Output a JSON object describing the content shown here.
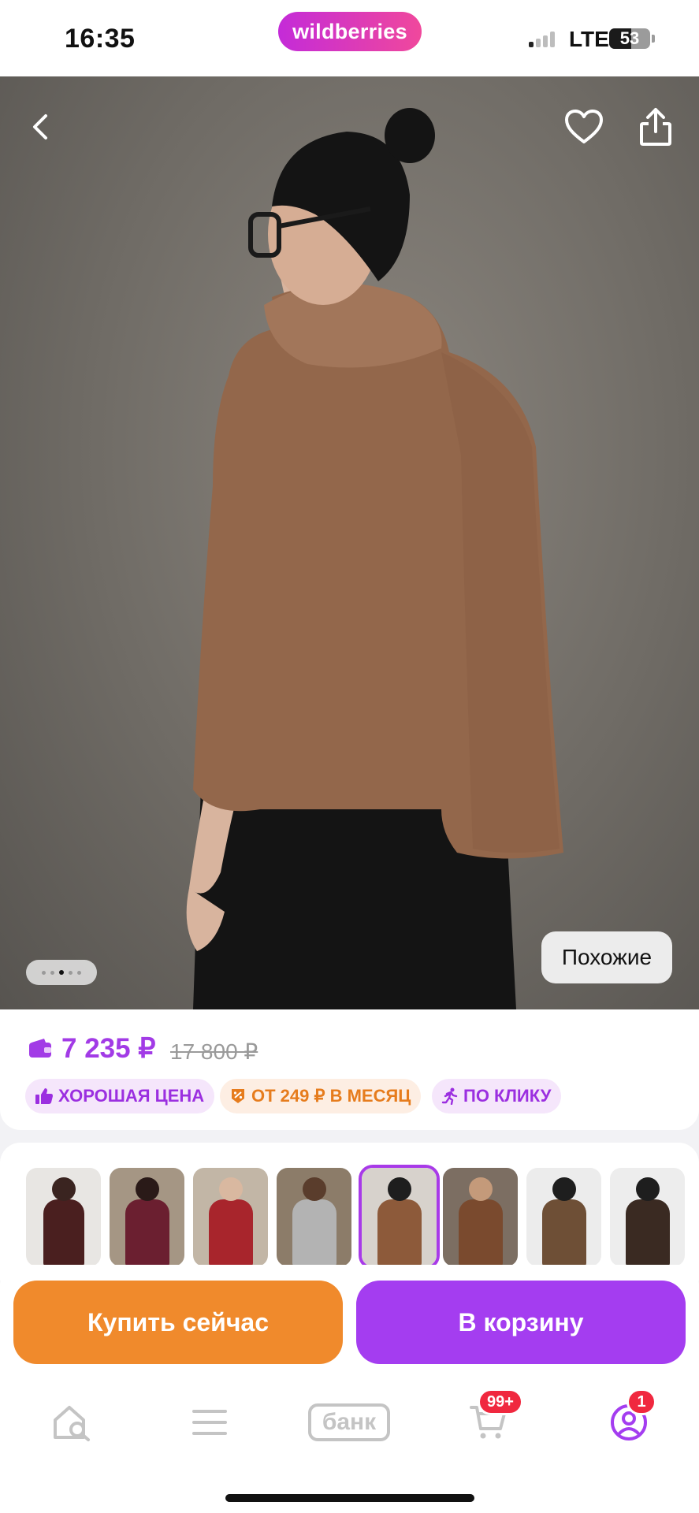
{
  "status_bar": {
    "time": "16:35",
    "brand": "wildberries",
    "network": "LTE",
    "battery_level": "53"
  },
  "hero": {
    "image_page_index": 3,
    "image_page_count": 5,
    "similar_label": "Похожие"
  },
  "price_block": {
    "price": "7 235 ₽",
    "old_price": "17 800 ₽",
    "badges": [
      {
        "label": "ХОРОШАЯ ЦЕНА",
        "icon": "thumbs-up-icon"
      },
      {
        "label": "ОТ 249 ₽ В МЕСЯЦ",
        "icon": "installment-percent-icon"
      },
      {
        "label": "ПО КЛИКУ",
        "icon": "running-person-icon"
      }
    ]
  },
  "thumbnails": {
    "selected_index": 4,
    "count": 8
  },
  "actions": {
    "buy_now": "Купить сейчас",
    "add_to_cart": "В корзину"
  },
  "bottom_nav": {
    "items": [
      "home-search-icon",
      "menu-icon",
      "bank-icon",
      "cart-icon",
      "profile-icon"
    ],
    "bank_label": "банк",
    "cart_badge": "99+",
    "profile_badge": "1"
  },
  "colors": {
    "accent_purple": "#a43df0",
    "buy_orange": "#f08a2c",
    "price_purple": "#a23be6",
    "badge_red": "#f0283f"
  }
}
